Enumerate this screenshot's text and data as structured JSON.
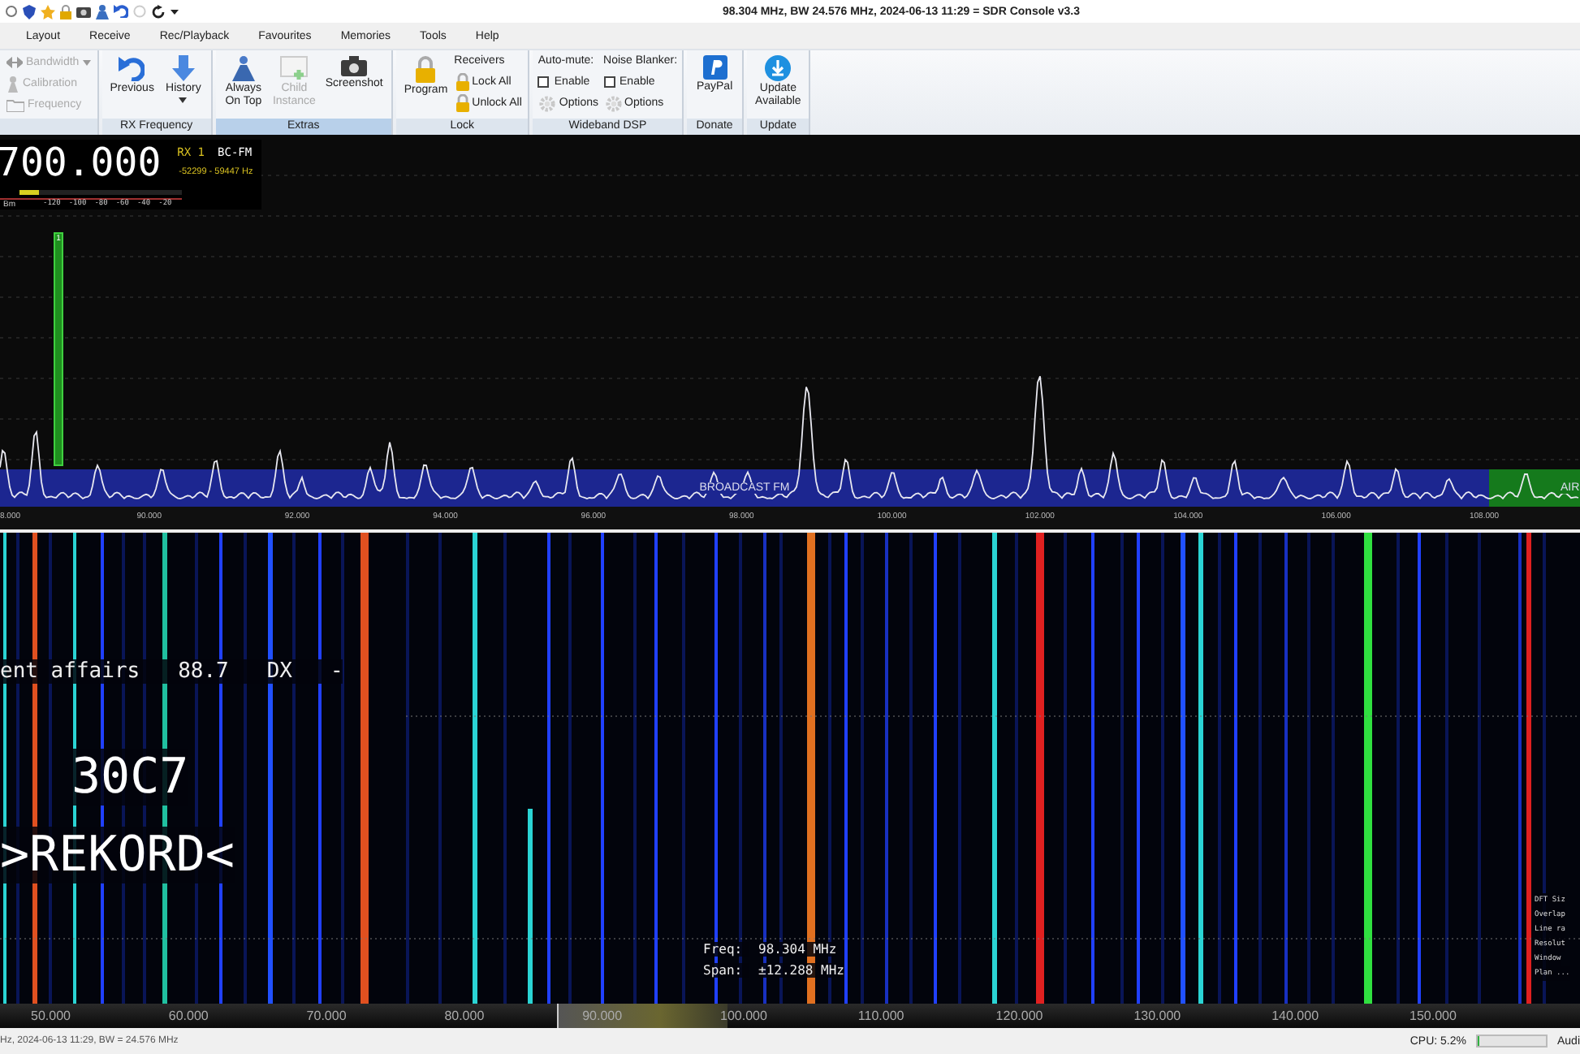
{
  "title_bar": {
    "title": "98.304 MHz, BW 24.576 MHz, 2024-06-13 11:29 = SDR Console v3.3"
  },
  "menu": [
    {
      "label": "Layout"
    },
    {
      "label": "Receive"
    },
    {
      "label": "Rec/Playback"
    },
    {
      "label": "Favourites"
    },
    {
      "label": "Memories"
    },
    {
      "label": "Tools"
    },
    {
      "label": "Help"
    }
  ],
  "ribbon": {
    "groups": [
      {
        "columns": [
          [
            {
              "kind": "small",
              "label": "Bandwidth",
              "disabled": true,
              "dropdown": true
            },
            {
              "kind": "small",
              "label": "Calibration",
              "disabled": true,
              "dropdown": false
            },
            {
              "kind": "small",
              "label": "Frequency",
              "disabled": true,
              "dropdown": false
            }
          ]
        ]
      },
      {
        "label": "RX Frequency",
        "highlighted": false,
        "columns": [
          [
            {
              "kind": "large",
              "label": "Previous",
              "disabled": false,
              "dropdown": false
            }
          ],
          [
            {
              "kind": "large",
              "label": "History",
              "disabled": false,
              "dropdown": true
            }
          ]
        ]
      },
      {
        "label": "Extras",
        "highlighted": true,
        "columns": [
          [
            {
              "kind": "large",
              "label": "Always On Top",
              "disabled": false,
              "dropdown": false
            }
          ],
          [
            {
              "kind": "large",
              "label": "Child Instance",
              "disabled": true,
              "dropdown": false
            }
          ],
          [
            {
              "kind": "large",
              "label": "Screenshot",
              "disabled": false,
              "dropdown": false
            }
          ]
        ]
      },
      {
        "label": "Lock",
        "highlighted": false,
        "columns": [
          [
            {
              "kind": "large",
              "label": "Program",
              "disabled": false,
              "dropdown": false
            }
          ],
          [
            {
              "kind": "heading",
              "label": "Receivers"
            },
            {
              "kind": "small",
              "label": "Lock All",
              "disabled": false,
              "dropdown": false
            },
            {
              "kind": "small",
              "label": "Unlock All",
              "disabled": false,
              "dropdown": false
            }
          ]
        ]
      },
      {
        "label": "Wideband DSP",
        "highlighted": false,
        "columns": [
          [
            {
              "kind": "heading",
              "label": "Auto-mute:"
            },
            {
              "kind": "check",
              "label": "Enable",
              "checked": false
            },
            {
              "kind": "small",
              "label": "Options",
              "disabled": false,
              "dropdown": false
            }
          ],
          [
            {
              "kind": "heading",
              "label": "Noise Blanker:"
            },
            {
              "kind": "check",
              "label": "Enable",
              "checked": false
            },
            {
              "kind": "small",
              "label": "Options",
              "disabled": false,
              "dropdown": false
            }
          ]
        ]
      },
      {
        "label": "Donate",
        "highlighted": false,
        "columns": [
          [
            {
              "kind": "large",
              "label": "PayPal",
              "disabled": false,
              "dropdown": false
            }
          ]
        ]
      },
      {
        "label": "Update",
        "highlighted": false,
        "columns": [
          [
            {
              "kind": "large",
              "label": "Update Available",
              "disabled": false,
              "dropdown": false
            }
          ]
        ]
      }
    ]
  },
  "readout": {
    "frequency": "700.000",
    "receiver": "RX 1",
    "mode": "BC-FM",
    "filter": "-52299 - 59447 Hz",
    "unit": "Bm",
    "meter": {
      "level": 0.12
    },
    "scale": [
      "-120",
      "-100",
      "-80",
      "-60",
      "-40",
      "-20"
    ]
  },
  "spectrum": {
    "marker_label": "1",
    "bands": [
      {
        "label": "BROADCAST FM",
        "color": "#1c2690"
      },
      {
        "label": "AIR",
        "color": "#157a1c"
      }
    ],
    "axis": [
      "8.000",
      "90.000",
      "92.000",
      "94.000",
      "96.000",
      "98.000",
      "100.000",
      "102.000",
      "104.000",
      "106.000",
      "108.000"
    ]
  },
  "waterfall": {
    "rds": "ent affairs   88.7   DX   -",
    "pi": "30C7",
    "ps": ">REKORD<",
    "freq_label": "Freq:",
    "freq_value": "98.304 MHz",
    "span_label": "Span:",
    "span_value": "±12.288 MHz",
    "info": [
      "DFT Siz",
      "Overlap",
      "Line ra",
      "Resolut",
      "Window",
      "Plan ..."
    ],
    "axis": [
      "50.000",
      "60.000",
      "70.000",
      "80.000",
      "90.000",
      "100.000",
      "110.000",
      "120.000",
      "130.000",
      "140.000",
      "150.000"
    ]
  },
  "status_bar": {
    "text": "Hz, 2024-06-13 11:29, BW = 24.576 MHz",
    "cpu": "CPU: 5.2%",
    "cpu_meter": {
      "level": 0.03
    },
    "audio": "Audi"
  }
}
